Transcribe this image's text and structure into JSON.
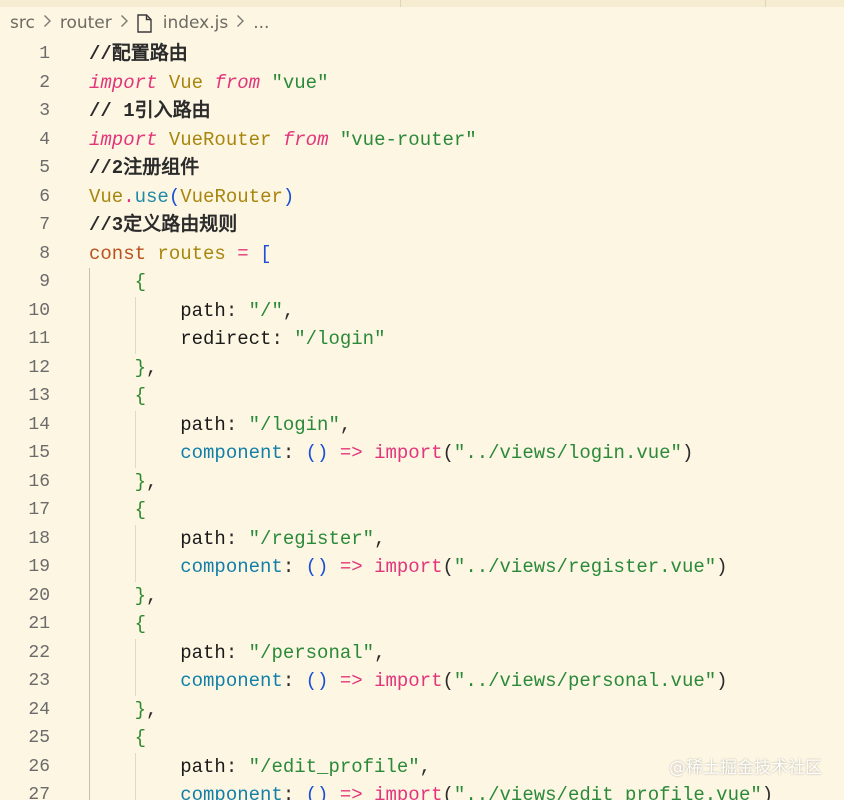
{
  "breadcrumb": {
    "items": [
      "src",
      "router",
      "index.js",
      "..."
    ],
    "file_icon": "file-icon",
    "separator_icon": "chevron-right-icon"
  },
  "editor": {
    "colors": {
      "background": "#fdf6e3",
      "keyword": "#e2357a",
      "string": "#2a8a3a",
      "identifier": "#a8860d",
      "property": "#127fa8",
      "const": "#b9521c"
    },
    "lines": [
      {
        "no": "1",
        "tokens": [
          [
            "comment",
            "//配置路由"
          ]
        ]
      },
      {
        "no": "2",
        "tokens": [
          [
            "keyword",
            "import"
          ],
          [
            "punc",
            " "
          ],
          [
            "ident",
            "Vue"
          ],
          [
            "punc",
            " "
          ],
          [
            "keyword",
            "from"
          ],
          [
            "punc",
            " "
          ],
          [
            "string",
            "\"vue\""
          ]
        ]
      },
      {
        "no": "3",
        "tokens": [
          [
            "comment",
            "// 1引入路由"
          ]
        ]
      },
      {
        "no": "4",
        "tokens": [
          [
            "keyword",
            "import"
          ],
          [
            "punc",
            " "
          ],
          [
            "ident",
            "VueRouter"
          ],
          [
            "punc",
            " "
          ],
          [
            "keyword",
            "from"
          ],
          [
            "punc",
            " "
          ],
          [
            "string",
            "\"vue-router\""
          ]
        ]
      },
      {
        "no": "5",
        "tokens": [
          [
            "comment",
            "//2注册组件"
          ]
        ]
      },
      {
        "no": "6",
        "tokens": [
          [
            "ident",
            "Vue"
          ],
          [
            "dot",
            "."
          ],
          [
            "method",
            "use"
          ],
          [
            "paren",
            "("
          ],
          [
            "ident",
            "VueRouter"
          ],
          [
            "paren",
            ")"
          ]
        ]
      },
      {
        "no": "7",
        "tokens": [
          [
            "comment",
            "//3定义路由规则"
          ]
        ]
      },
      {
        "no": "8",
        "tokens": [
          [
            "kwconst",
            "const"
          ],
          [
            "punc",
            " "
          ],
          [
            "ident",
            "routes"
          ],
          [
            "punc",
            " "
          ],
          [
            "op",
            "="
          ],
          [
            "punc",
            " "
          ],
          [
            "bracket",
            "["
          ]
        ]
      },
      {
        "no": "9",
        "tokens": [
          [
            "punc",
            "    "
          ],
          [
            "brace",
            "{"
          ]
        ]
      },
      {
        "no": "10",
        "tokens": [
          [
            "punc",
            "        "
          ],
          [
            "prop",
            "path"
          ],
          [
            "punc",
            ": "
          ],
          [
            "string",
            "\"/\""
          ],
          [
            "punc",
            ","
          ]
        ]
      },
      {
        "no": "11",
        "tokens": [
          [
            "punc",
            "        "
          ],
          [
            "prop",
            "redirect"
          ],
          [
            "punc",
            ": "
          ],
          [
            "string",
            "\"/login\""
          ]
        ]
      },
      {
        "no": "12",
        "tokens": [
          [
            "punc",
            "    "
          ],
          [
            "brace",
            "}"
          ],
          [
            "punc",
            ","
          ]
        ]
      },
      {
        "no": "13",
        "tokens": [
          [
            "punc",
            "    "
          ],
          [
            "brace",
            "{"
          ]
        ]
      },
      {
        "no": "14",
        "tokens": [
          [
            "punc",
            "        "
          ],
          [
            "prop",
            "path"
          ],
          [
            "punc",
            ": "
          ],
          [
            "string",
            "\"/login\""
          ],
          [
            "punc",
            ","
          ]
        ]
      },
      {
        "no": "15",
        "tokens": [
          [
            "punc",
            "        "
          ],
          [
            "prop2",
            "component"
          ],
          [
            "punc",
            ": "
          ],
          [
            "paren",
            "()"
          ],
          [
            "punc",
            " "
          ],
          [
            "op",
            "=>"
          ],
          [
            "punc",
            " "
          ],
          [
            "keyword2",
            "import"
          ],
          [
            "punc",
            "("
          ],
          [
            "string",
            "\"../views/login.vue\""
          ],
          [
            "punc",
            ")"
          ]
        ]
      },
      {
        "no": "16",
        "tokens": [
          [
            "punc",
            "    "
          ],
          [
            "brace",
            "}"
          ],
          [
            "punc",
            ","
          ]
        ]
      },
      {
        "no": "17",
        "tokens": [
          [
            "punc",
            "    "
          ],
          [
            "brace",
            "{"
          ]
        ]
      },
      {
        "no": "18",
        "tokens": [
          [
            "punc",
            "        "
          ],
          [
            "prop",
            "path"
          ],
          [
            "punc",
            ": "
          ],
          [
            "string",
            "\"/register\""
          ],
          [
            "punc",
            ","
          ]
        ]
      },
      {
        "no": "19",
        "tokens": [
          [
            "punc",
            "        "
          ],
          [
            "prop2",
            "component"
          ],
          [
            "punc",
            ": "
          ],
          [
            "paren",
            "()"
          ],
          [
            "punc",
            " "
          ],
          [
            "op",
            "=>"
          ],
          [
            "punc",
            " "
          ],
          [
            "keyword2",
            "import"
          ],
          [
            "punc",
            "("
          ],
          [
            "string",
            "\"../views/register.vue\""
          ],
          [
            "punc",
            ")"
          ]
        ]
      },
      {
        "no": "20",
        "tokens": [
          [
            "punc",
            "    "
          ],
          [
            "brace",
            "}"
          ],
          [
            "punc",
            ","
          ]
        ]
      },
      {
        "no": "21",
        "tokens": [
          [
            "punc",
            "    "
          ],
          [
            "brace",
            "{"
          ]
        ]
      },
      {
        "no": "22",
        "tokens": [
          [
            "punc",
            "        "
          ],
          [
            "prop",
            "path"
          ],
          [
            "punc",
            ": "
          ],
          [
            "string",
            "\"/personal\""
          ],
          [
            "punc",
            ","
          ]
        ]
      },
      {
        "no": "23",
        "tokens": [
          [
            "punc",
            "        "
          ],
          [
            "prop2",
            "component"
          ],
          [
            "punc",
            ": "
          ],
          [
            "paren",
            "()"
          ],
          [
            "punc",
            " "
          ],
          [
            "op",
            "=>"
          ],
          [
            "punc",
            " "
          ],
          [
            "keyword2",
            "import"
          ],
          [
            "punc",
            "("
          ],
          [
            "string",
            "\"../views/personal.vue\""
          ],
          [
            "punc",
            ")"
          ]
        ]
      },
      {
        "no": "24",
        "tokens": [
          [
            "punc",
            "    "
          ],
          [
            "brace",
            "}"
          ],
          [
            "punc",
            ","
          ]
        ]
      },
      {
        "no": "25",
        "tokens": [
          [
            "punc",
            "    "
          ],
          [
            "brace",
            "{"
          ]
        ]
      },
      {
        "no": "26",
        "tokens": [
          [
            "punc",
            "        "
          ],
          [
            "prop",
            "path"
          ],
          [
            "punc",
            ": "
          ],
          [
            "string",
            "\"/edit_profile\""
          ],
          [
            "punc",
            ","
          ]
        ]
      },
      {
        "no": "27",
        "tokens": [
          [
            "punc",
            "        "
          ],
          [
            "prop2",
            "component"
          ],
          [
            "punc",
            ": "
          ],
          [
            "paren",
            "()"
          ],
          [
            "punc",
            " "
          ],
          [
            "op",
            "=>"
          ],
          [
            "punc",
            " "
          ],
          [
            "keyword2",
            "import"
          ],
          [
            "punc",
            "("
          ],
          [
            "string",
            "\"../views/edit_profile.vue\""
          ],
          [
            "punc",
            ")"
          ]
        ]
      }
    ]
  },
  "watermark": {
    "text": "@稀土掘金技术社区"
  }
}
